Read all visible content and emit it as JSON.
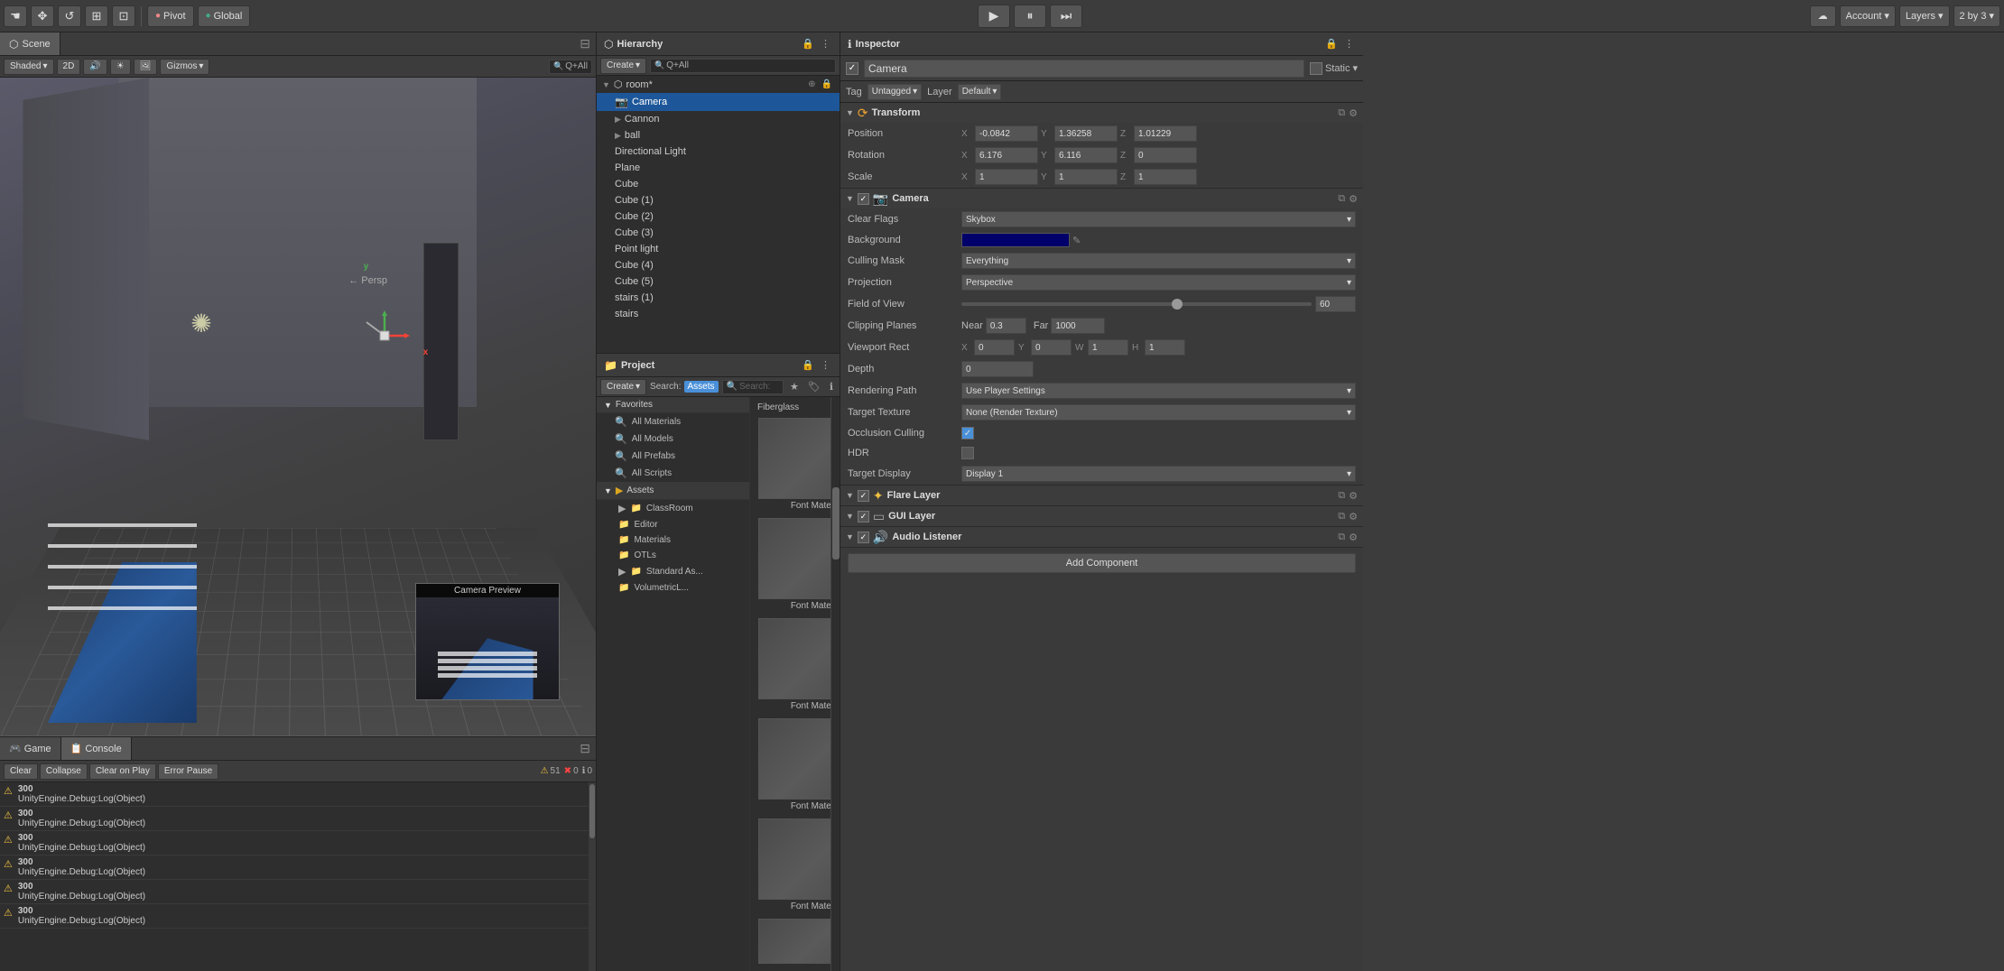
{
  "app": {
    "title": "Unity"
  },
  "topToolbar": {
    "transformBtn1": "⊕",
    "transformBtn2": "✥",
    "transformBtn3": "↺",
    "transformBtn4": "⊞",
    "transformBtn5": "⊡",
    "pivotLabel": "Pivot",
    "globalLabel": "Global",
    "playBtn": "▶",
    "pauseBtn": "⏸",
    "stepBtn": "⏭",
    "cloudBtn": "☁",
    "accountLabel": "Account",
    "layersLabel": "Layers",
    "layoutLabel": "2 by 3"
  },
  "sceneView": {
    "tabLabel": "Scene",
    "shadingMode": "Shaded",
    "view2D": "2D",
    "gizmosLabel": "Gizmos",
    "searchPlaceholder": "Q+All",
    "sunIcon": "☀",
    "cameraPreviewTitle": "Camera Preview",
    "perspLabel": "← Persp"
  },
  "bottomPanel": {
    "gameTab": "Game",
    "consoleTab": "Console",
    "clearBtn": "Clear",
    "collapseBtn": "Collapse",
    "clearOnPlayBtn": "Clear on Play",
    "errorPauseBtn": "Error Pause",
    "warningCount": "51",
    "errorCount": "0",
    "infoCount": "0",
    "entries": [
      {
        "num": "300",
        "msg": "UnityEngine.Debug:Log(Object)"
      },
      {
        "num": "300",
        "msg": "UnityEngine.Debug:Log(Object)"
      },
      {
        "num": "300",
        "msg": "UnityEngine.Debug:Log(Object)"
      },
      {
        "num": "300",
        "msg": "UnityEngine.Debug:Log(Object)"
      },
      {
        "num": "300",
        "msg": "UnityEngine.Debug:Log(Object)"
      }
    ]
  },
  "hierarchy": {
    "title": "Hierarchy",
    "createBtn": "Create",
    "searchPlaceholder": "Q+All",
    "sceneLabel": "room*",
    "items": [
      {
        "label": "Camera",
        "indent": 1,
        "selected": true
      },
      {
        "label": "Cannon",
        "indent": 1,
        "selected": false
      },
      {
        "label": "ball",
        "indent": 1,
        "selected": false,
        "hasArrow": true
      },
      {
        "label": "Directional Light",
        "indent": 1,
        "selected": false
      },
      {
        "label": "Plane",
        "indent": 1,
        "selected": false
      },
      {
        "label": "Cube",
        "indent": 1,
        "selected": false
      },
      {
        "label": "Cube (1)",
        "indent": 1,
        "selected": false
      },
      {
        "label": "Cube (2)",
        "indent": 1,
        "selected": false
      },
      {
        "label": "Cube (3)",
        "indent": 1,
        "selected": false
      },
      {
        "label": "Point light",
        "indent": 1,
        "selected": false
      },
      {
        "label": "Cube (4)",
        "indent": 1,
        "selected": false
      },
      {
        "label": "Cube (5)",
        "indent": 1,
        "selected": false
      },
      {
        "label": "stairs (1)",
        "indent": 1,
        "selected": false
      },
      {
        "label": "stairs",
        "indent": 1,
        "selected": false
      }
    ]
  },
  "project": {
    "title": "Project",
    "createBtn": "Create",
    "searchLabel": "Search:",
    "assetsBtn": "Assets",
    "favorites": {
      "label": "Favorites",
      "items": [
        {
          "label": "All Materials"
        },
        {
          "label": "All Models"
        },
        {
          "label": "All Prefabs"
        },
        {
          "label": "All Scripts"
        }
      ]
    },
    "assetsTree": {
      "label": "Assets",
      "items": [
        {
          "label": "ClassRoom",
          "indent": 1
        },
        {
          "label": "Editor",
          "indent": 1
        },
        {
          "label": "Materials",
          "indent": 1
        },
        {
          "label": "OTLs",
          "indent": 1
        },
        {
          "label": "Standard As...",
          "indent": 1
        },
        {
          "label": "VolumetricL...",
          "indent": 1
        }
      ]
    },
    "assetItems": [
      {
        "label": "Font Material",
        "type": "material"
      },
      {
        "label": "Font Material",
        "type": "material"
      },
      {
        "label": "Font Material",
        "type": "material"
      },
      {
        "label": "Font Material",
        "type": "material"
      },
      {
        "label": "Font Material",
        "type": "material"
      }
    ],
    "topAsset": "Fiberglass"
  },
  "inspector": {
    "title": "Inspector",
    "objectName": "Camera",
    "staticLabel": "Static",
    "tag": "Untagged",
    "layer": "Default",
    "transform": {
      "title": "Transform",
      "positionLabel": "Position",
      "posX": "-0.0842",
      "posY": "1.36258",
      "posZ": "1.01229",
      "rotationLabel": "Rotation",
      "rotX": "6.176",
      "rotY": "6.116",
      "rotZ": "0",
      "scaleLabel": "Scale",
      "scaleX": "1",
      "scaleY": "1",
      "scaleZ": "1"
    },
    "camera": {
      "title": "Camera",
      "clearFlagsLabel": "Clear Flags",
      "clearFlagsValue": "Skybox",
      "backgroundLabel": "Background",
      "cullingMaskLabel": "Culling Mask",
      "cullingMaskValue": "Everything",
      "projectionLabel": "Projection",
      "projectionValue": "Perspective",
      "fovLabel": "Field of View",
      "fovValue": "60",
      "clippingLabel": "Clipping Planes",
      "nearLabel": "Near",
      "nearValue": "0.3",
      "farLabel": "Far",
      "farValue": "1000",
      "viewportRectLabel": "Viewport Rect",
      "vpX": "0",
      "vpY": "0",
      "vpW": "1",
      "vpH": "1",
      "depthLabel": "Depth",
      "depthValue": "0",
      "renderingPathLabel": "Rendering Path",
      "renderingPathValue": "Use Player Settings",
      "targetTextureLabel": "Target Texture",
      "targetTextureValue": "None (Render Texture)",
      "occlusionLabel": "Occlusion Culling",
      "hdrLabel": "HDR",
      "targetDisplayLabel": "Target Display",
      "targetDisplayValue": "Display 1"
    },
    "flareLayer": {
      "title": "Flare Layer"
    },
    "guiLayer": {
      "title": "GUI Layer"
    },
    "audioListener": {
      "title": "Audio Listener"
    },
    "addComponentBtn": "Add Component"
  }
}
